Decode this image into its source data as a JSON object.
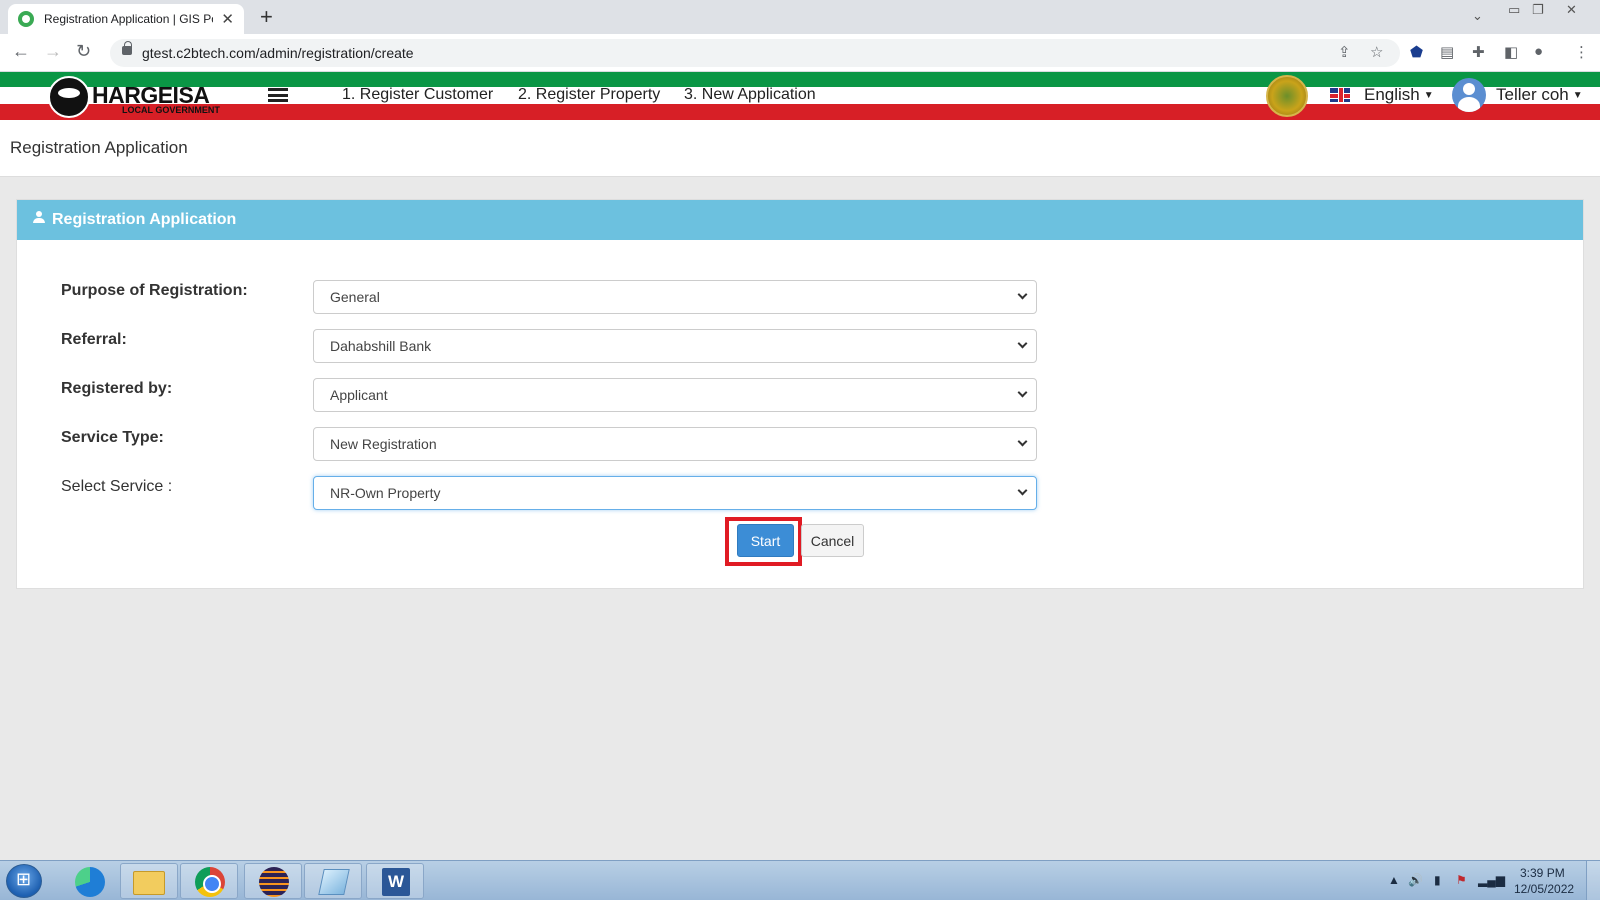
{
  "browser": {
    "tab_title": "Registration Application | GIS Por",
    "url": "gtest.c2btech.com/admin/registration/create"
  },
  "header": {
    "logo_text": "HARGEISA",
    "logo_sub": "LOCAL GOVERNMENT",
    "nav": [
      "1. Register Customer",
      "2. Register Property",
      "3. New Application"
    ],
    "language": "English",
    "user": "Teller coh"
  },
  "page": {
    "title": "Registration Application"
  },
  "panel": {
    "title": "Registration Application",
    "fields": [
      {
        "label": "Purpose of Registration:",
        "value": "General"
      },
      {
        "label": "Referral:",
        "value": "Dahabshill Bank"
      },
      {
        "label": "Registered by:",
        "value": "Applicant"
      },
      {
        "label": "Service Type:",
        "value": "New Registration"
      },
      {
        "label": "Select Service :",
        "value": "NR-Own Property"
      }
    ],
    "start_label": "Start",
    "cancel_label": "Cancel"
  },
  "taskbar": {
    "time": "3:39 PM",
    "date": "12/05/2022"
  },
  "colors": {
    "header_green": "#0a9645",
    "header_red": "#d71f26",
    "panel_header": "#6cc1df",
    "primary_button": "#3c8dd6",
    "highlight": "#e01b24"
  }
}
